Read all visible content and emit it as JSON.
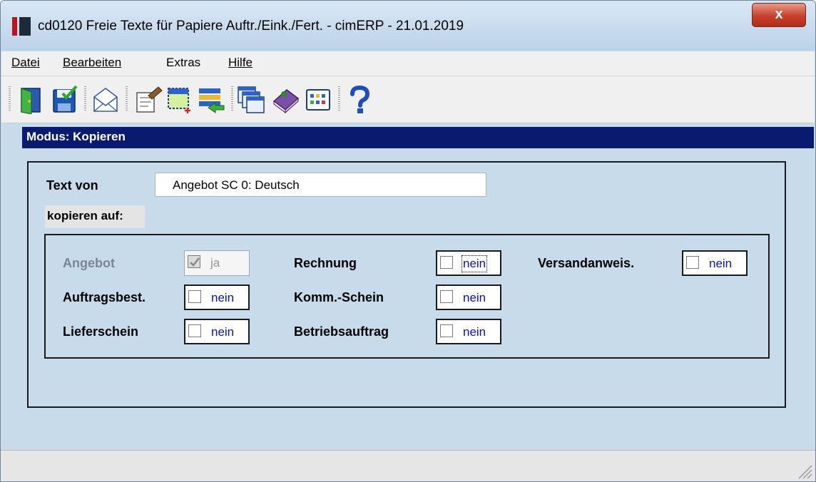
{
  "window": {
    "title": "cd0120 Freie Texte für Papiere Auftr./Eink./Fert. - cimERP - 21.01.2019",
    "close_label": "x"
  },
  "menu": [
    {
      "label": "Datei"
    },
    {
      "label": "Bearbeiten"
    },
    {
      "label": "Extras"
    },
    {
      "label": "Hilfe"
    }
  ],
  "toolbar_icons": [
    "exit-door-icon",
    "save-icon",
    "email-icon",
    "edit-notes-icon",
    "select-window-icon",
    "import-list-icon",
    "copy-windows-icon",
    "book-icon",
    "grid-view-icon",
    "help-icon"
  ],
  "mode": {
    "text": "Modus: Kopieren"
  },
  "form": {
    "text_from_label": "Text von",
    "text_from_value": "Angebot SC 0: Deutsch",
    "copy_to_label": "kopieren auf:"
  },
  "options": {
    "angebot": {
      "label": "Angebot",
      "value": "ja",
      "checked": true,
      "disabled": true
    },
    "auftragsbest": {
      "label": "Auftragsbest.",
      "value": "nein",
      "checked": false
    },
    "lieferschein": {
      "label": "Lieferschein",
      "value": "nein",
      "checked": false
    },
    "rechnung": {
      "label": "Rechnung",
      "value": "nein",
      "checked": false,
      "focused": true
    },
    "kommschein": {
      "label": "Komm.-Schein",
      "value": "nein",
      "checked": false
    },
    "betriebsauftrag": {
      "label": "Betriebsauftrag",
      "value": "nein",
      "checked": false
    },
    "versandanweis": {
      "label": "Versandanweis.",
      "value": "nein",
      "checked": false
    }
  },
  "colors": {
    "mode_bar": "#0a1a6e",
    "panel_bg": "#c8dbeb",
    "value_text": "#0b16a0"
  }
}
